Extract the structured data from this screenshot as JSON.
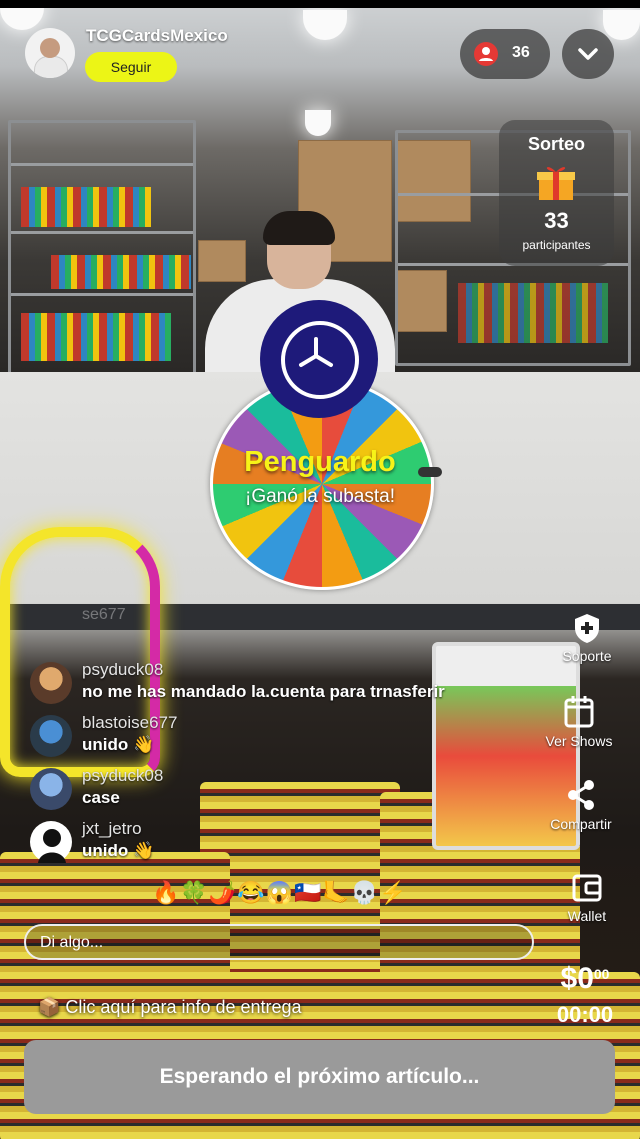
{
  "header": {
    "host_name": "TCGCardsMexico",
    "follow_label": "Seguir",
    "viewer_count": "36"
  },
  "giveaway": {
    "title": "Sorteo",
    "count": "33",
    "label": "participantes"
  },
  "wheel": {
    "winner_name": "Penguardo",
    "winner_message": "¡Ganó la subasta!"
  },
  "side_menu": {
    "support": "Soporte",
    "shows": "Ver Shows",
    "share": "Compartir",
    "wallet": "Wallet"
  },
  "chat": {
    "faded_user": "se677",
    "messages": [
      {
        "user": "psyduck08",
        "text": "no me has mandado la.cuenta para  trnasferir"
      },
      {
        "user": "blastoise677",
        "text": "unido 👋"
      },
      {
        "user": "psyduck08",
        "text": "case"
      },
      {
        "user": "jxt_jetro",
        "text": "unido 👋"
      }
    ],
    "emoji_bar": "🔥🍀🌶️😂😱🇨🇱🦶💀⚡",
    "input_placeholder": "Di algo..."
  },
  "delivery_info": "📦 Clic aquí para info de entrega",
  "price": {
    "dollars": "$0",
    "cents": "00"
  },
  "timer": "00:00",
  "waiting_label": "Esperando el próximo artículo...",
  "colors": {
    "follow": "#ecf516",
    "winner": "#f7f318",
    "viewer_badge": "#e53935",
    "hub": "#1e1a7a"
  }
}
